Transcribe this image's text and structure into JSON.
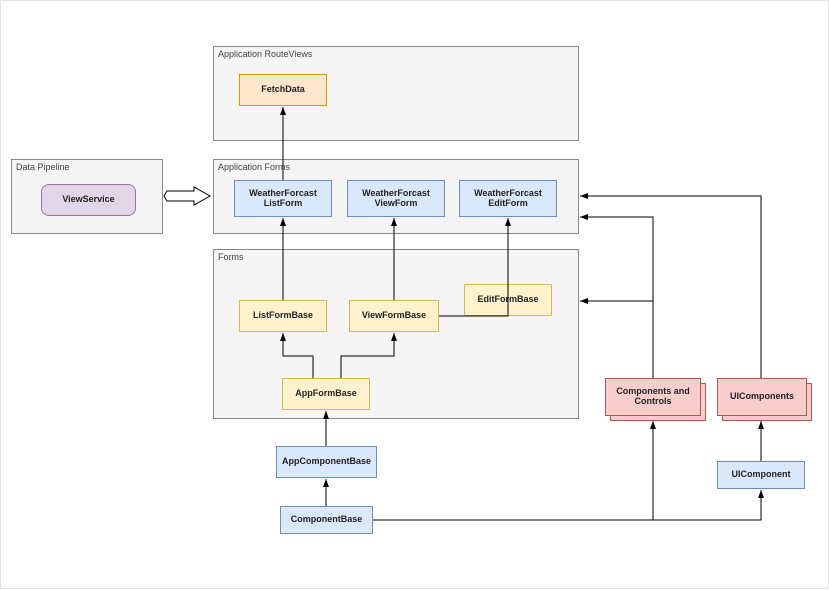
{
  "groups": {
    "data_pipeline": "Data Pipeline",
    "route_views": "Application RouteViews",
    "app_forms": "Application Forms",
    "forms": "Forms"
  },
  "nodes": {
    "view_service": "ViewService",
    "fetch_data": "FetchData",
    "wf_list_form": "WeatherForcast\nListForm",
    "wf_view_form": "WeatherForcast\nViewForm",
    "wf_edit_form": "WeatherForcast\nEditForm",
    "list_form_base": "ListFormBase",
    "view_form_base": "ViewFormBase",
    "edit_form_base": "EditFormBase",
    "app_form_base": "AppFormBase",
    "app_component_base": "AppComponentBase",
    "component_base": "ComponentBase",
    "components_controls": "Components and\nControls",
    "ui_components": "UIComponents",
    "ui_component": "UIComponent"
  },
  "colors": {
    "blue_fill": "#DAE8FC",
    "blue_stroke": "#6C8EBF",
    "purple_fill": "#E1D5E7",
    "purple_stroke": "#9673A6",
    "orange_fill": "#FFE6CC",
    "orange_stroke": "#D79B00",
    "yellow_fill": "#FFF2CC",
    "yellow_stroke": "#D6B656",
    "red_fill": "#F8CECC",
    "red_stroke": "#B85450",
    "group_fill": "#f5f5f5",
    "group_stroke": "#888888",
    "arrow": "#000000"
  }
}
